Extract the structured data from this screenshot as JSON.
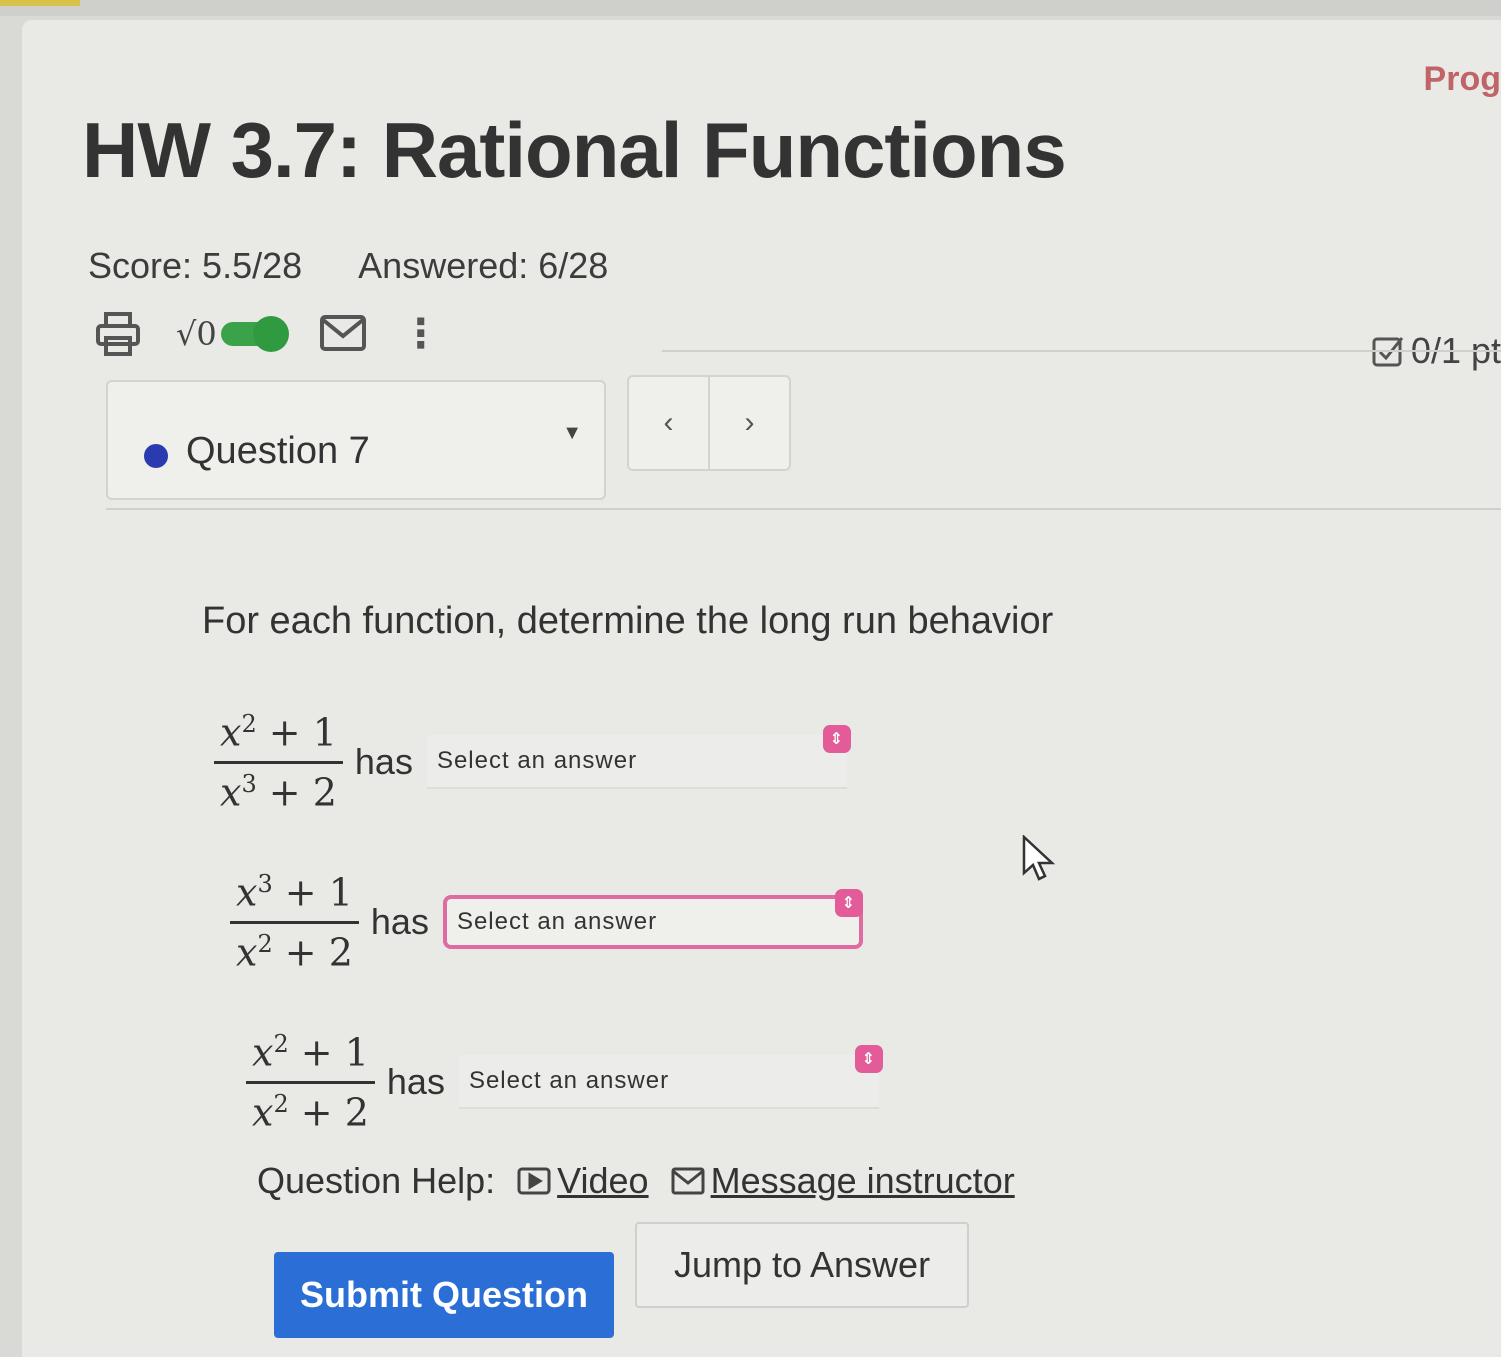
{
  "header": {
    "title": "HW 3.7: Rational Functions",
    "progress_link": "Prog"
  },
  "stats": {
    "score": "Score: 5.5/28",
    "answered": "Answered: 6/28"
  },
  "toolbar": {
    "math_toggle_label": "√0",
    "math_toggle_state": "on"
  },
  "question_nav": {
    "selected": "Question 7",
    "prev_label": "‹",
    "next_label": "›",
    "points": "0/1 pt"
  },
  "question": {
    "prompt": "For each function, determine the long run behavior",
    "items": [
      {
        "num_var": "x",
        "num_exp": "2",
        "num_rest": " + 1",
        "den_var": "x",
        "den_exp": "3",
        "den_rest": " + 2",
        "connector": "has",
        "answer_placeholder": "Select an answer"
      },
      {
        "num_var": "x",
        "num_exp": "3",
        "num_rest": " + 1",
        "den_var": "x",
        "den_exp": "2",
        "den_rest": " + 2",
        "connector": "has",
        "answer_placeholder": "Select an answer"
      },
      {
        "num_var": "x",
        "num_exp": "2",
        "num_rest": " + 1",
        "den_var": "x",
        "den_exp": "2",
        "den_rest": " + 2",
        "connector": "has",
        "answer_placeholder": "Select an answer"
      }
    ]
  },
  "help": {
    "label": "Question Help:",
    "video_label": "Video",
    "message_label": "Message instructor"
  },
  "actions": {
    "submit_label": "Submit Question",
    "jump_label": "Jump to Answer"
  },
  "colors": {
    "primary_button": "#2b6fd6",
    "question_dot": "#2a3bb0",
    "toggle_on": "#3aa34a",
    "select_accent": "#e35b98"
  }
}
